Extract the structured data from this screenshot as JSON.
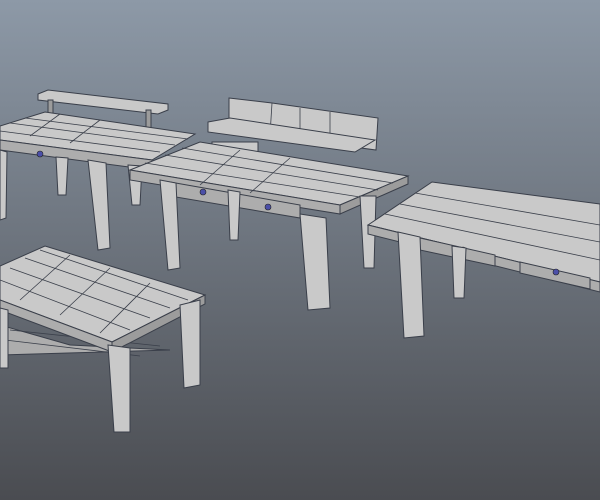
{
  "scene": {
    "view": "3d-viewport",
    "background_top": "#8d99a7",
    "background_bottom": "#4a4c51",
    "model_color": "#c9c9c9",
    "wireframe_color": "#3a3f4a",
    "knob_color": "#4b4fa8"
  }
}
